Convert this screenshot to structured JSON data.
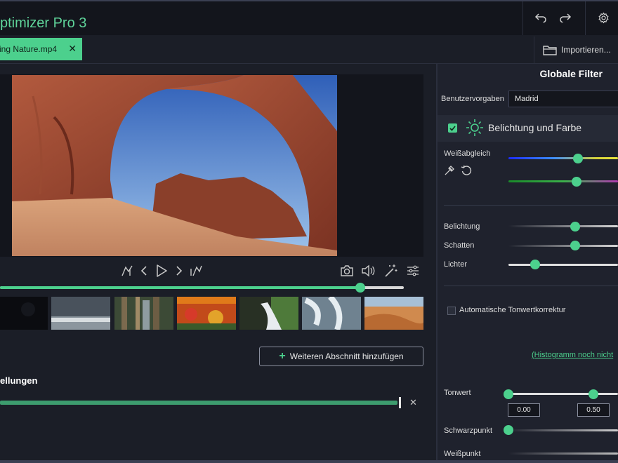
{
  "app": {
    "title": "ptimizer Pro 3"
  },
  "toolbar": {
    "undo_icon": "undo-icon",
    "redo_icon": "redo-icon",
    "settings_icon": "gear-icon"
  },
  "tabs": {
    "file_name": "ing Nature.mp4"
  },
  "import": {
    "label": "Importieren..."
  },
  "player": {
    "progress_fraction": 0.893
  },
  "sections": {
    "add_label": "Weiteren Abschnitt hinzufügen",
    "heading": "ellungen"
  },
  "panel": {
    "title": "Globale Filter",
    "presets_label": "Benutzervorgaben",
    "presets_value": "Madrid",
    "section_title": "Belichtung und Farbe",
    "white_balance_label": "Weißabgleich",
    "exposure_label": "Belichtung",
    "shadows_label": "Schatten",
    "highlights_label": "Lichter",
    "auto_tone_label": "Automatische Tonwertkorrektur",
    "histogram_link": "(Histogramm noch nicht",
    "tone_label": "Tonwert",
    "tone_min": "0.00",
    "tone_mid": "0.50",
    "black_point_label": "Schwarzpunkt",
    "white_point_label": "Weißpunkt"
  },
  "colors": {
    "accent": "#4cd08d",
    "background": "#1b1e27",
    "panel": "#1f222d"
  }
}
